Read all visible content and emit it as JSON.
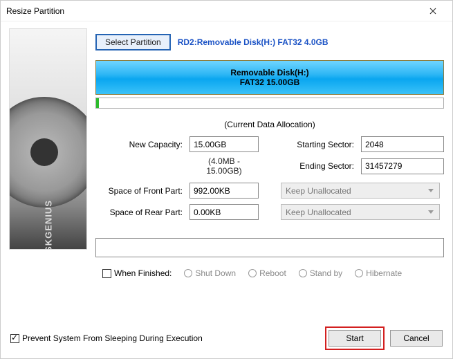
{
  "window": {
    "title": "Resize Partition"
  },
  "brand": "DISKGENIUS",
  "top": {
    "select_btn": "Select Partition",
    "partition_label": "RD2:Removable Disk(H:) FAT32 4.0GB"
  },
  "part_bar": {
    "line1": "Removable Disk(H:)",
    "line2": "FAT32 15.00GB"
  },
  "alloc_title": "(Current Data Allocation)",
  "labels": {
    "new_capacity": "New Capacity:",
    "starting_sector": "Starting Sector:",
    "ending_sector": "Ending Sector:",
    "space_front": "Space of Front Part:",
    "space_rear": "Space of Rear Part:"
  },
  "values": {
    "new_capacity": "15.00GB",
    "range_note": "(4.0MB - 15.00GB)",
    "starting_sector": "2048",
    "ending_sector": "31457279",
    "space_front": "992.00KB",
    "space_rear": "0.00KB"
  },
  "combos": {
    "front": "Keep Unallocated",
    "rear": "Keep Unallocated"
  },
  "finish": {
    "label": "When Finished:",
    "options": [
      "Shut Down",
      "Reboot",
      "Stand by",
      "Hibernate"
    ]
  },
  "prevent_sleep": "Prevent System From Sleeping During Execution",
  "buttons": {
    "start": "Start",
    "cancel": "Cancel"
  }
}
